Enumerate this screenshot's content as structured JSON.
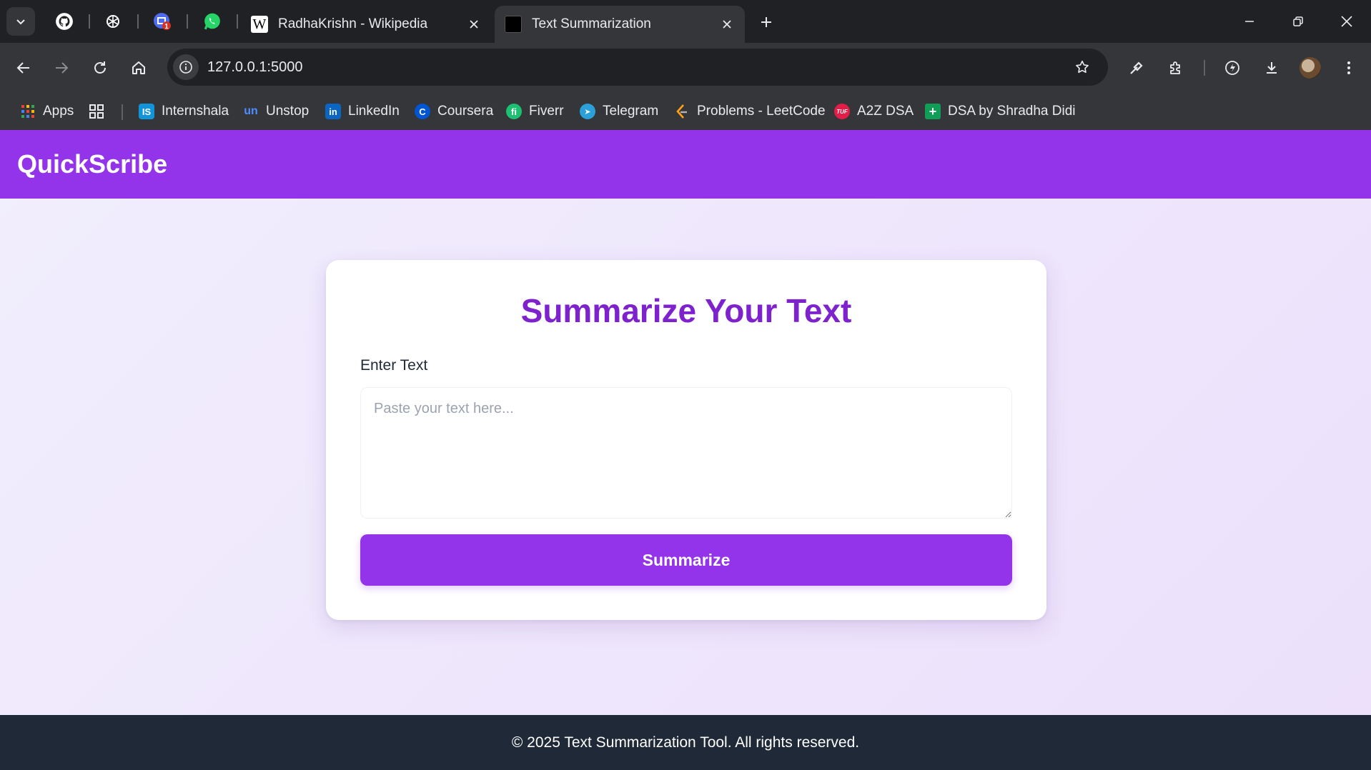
{
  "browser": {
    "tabs": [
      {
        "title": "RadhaKrishn - Wikipedia",
        "favicon": "wikipedia-icon",
        "active": false
      },
      {
        "title": "Text Summarization",
        "favicon": "site-icon",
        "active": true
      }
    ],
    "pinned_tabs": [
      "github-icon",
      "chatgpt-icon",
      "gmail-icon",
      "whatsapp-icon"
    ],
    "pinned_badge": "1",
    "wikipedia_favicon_letter": "W",
    "url": "127.0.0.1:5000",
    "bookmarks": [
      {
        "label": "Apps",
        "icon": "apps-grid-icon"
      },
      {
        "label": "Internshala",
        "icon": "internshala-icon",
        "glyph": "IS",
        "color": "#1295d8"
      },
      {
        "label": "Unstop",
        "icon": "unstop-icon",
        "glyph": "un",
        "color": "#1c4980"
      },
      {
        "label": "LinkedIn",
        "icon": "linkedin-icon",
        "glyph": "in",
        "color": "#0a66c2"
      },
      {
        "label": "Coursera",
        "icon": "coursera-icon",
        "glyph": "C",
        "color": "#0056d2"
      },
      {
        "label": "Fiverr",
        "icon": "fiverr-icon",
        "glyph": "fi",
        "color": "#1dbf73"
      },
      {
        "label": "Telegram",
        "icon": "telegram-icon",
        "glyph": "➤",
        "color": "#2aa1da"
      },
      {
        "label": "Problems - LeetCode",
        "icon": "leetcode-icon",
        "glyph": "",
        "color": "#ffa116"
      },
      {
        "label": "A2Z DSA",
        "icon": "tuf-icon",
        "glyph": "TUF",
        "color": "#e11d48"
      },
      {
        "label": "DSA by Shradha Didi",
        "icon": "sheets-icon",
        "glyph": "+",
        "color": "#0f9d58"
      }
    ]
  },
  "app": {
    "brand": "QuickScribe",
    "title": "Summarize Your Text",
    "input_label": "Enter Text",
    "input_value": "",
    "input_placeholder": "Paste your text here...",
    "button_label": "Summarize",
    "footer": "© 2025 Text Summarization Tool. All rights reserved.",
    "colors": {
      "primary": "#9333ea",
      "title": "#7e22ce",
      "footer_bg": "#1f2937"
    }
  }
}
